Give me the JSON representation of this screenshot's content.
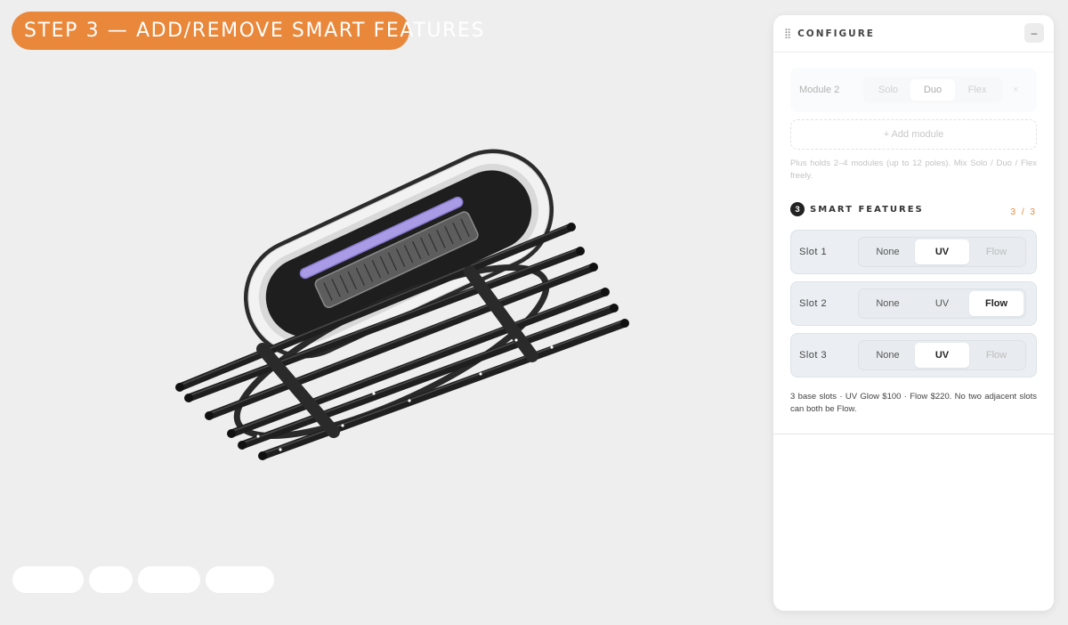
{
  "step": {
    "label": "STEP 3 — ADD/REMOVE SMART FEATURES"
  },
  "panel": {
    "title": "CONFIGURE",
    "collapse_label": "–",
    "module": {
      "label": "Module 2",
      "options": [
        "Solo",
        "Duo",
        "Flex"
      ],
      "selected": "Duo",
      "remove_label": "×"
    },
    "add_module_label": "+ Add module",
    "plus_note": "Plus holds 2–4 modules (up to 12 poles). Mix Solo / Duo / Flex freely.",
    "smart": {
      "number": "3",
      "title": "SMART FEATURES",
      "count": "3 / 3",
      "option_labels": [
        "None",
        "UV",
        "Flow"
      ],
      "slots": [
        {
          "label": "Slot 1",
          "selected": "UV",
          "disabled": "Flow"
        },
        {
          "label": "Slot 2",
          "selected": "Flow",
          "disabled": ""
        },
        {
          "label": "Slot 3",
          "selected": "UV",
          "disabled": "Flow"
        }
      ],
      "note": "3 base slots · UV Glow $100 · Flow $220. No two adjacent slots can both be Flow."
    }
  },
  "colors": {
    "accent": "#e9873a",
    "uv_glow": "#a99be6",
    "frame": "#1f1f1f"
  }
}
